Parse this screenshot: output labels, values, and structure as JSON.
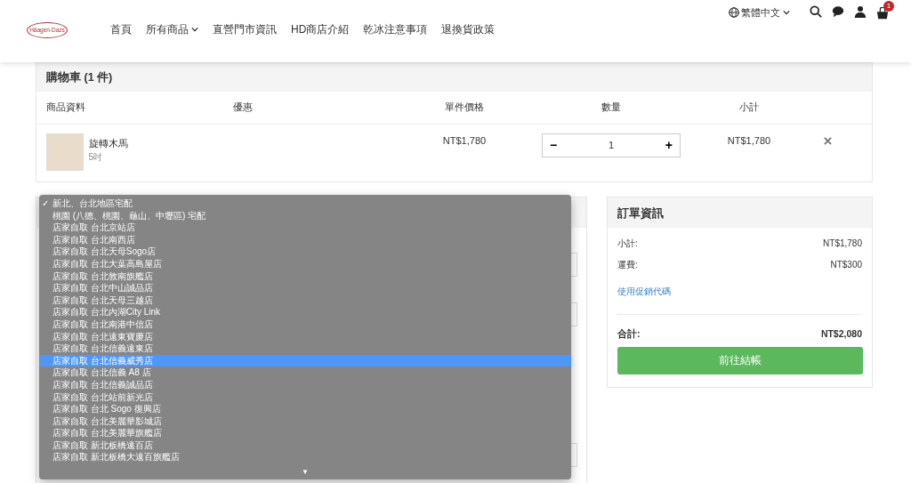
{
  "header": {
    "logo_text": "Häagen-Dazs",
    "nav": [
      {
        "label": "首頁",
        "dropdown": false
      },
      {
        "label": "所有商品",
        "dropdown": true
      },
      {
        "label": "直營門市資訊",
        "dropdown": false
      },
      {
        "label": "HD商店介紹",
        "dropdown": false
      },
      {
        "label": "乾冰注意事項",
        "dropdown": false
      },
      {
        "label": "退換貨政策",
        "dropdown": false
      }
    ],
    "language": "繁體中文",
    "cart_count": "1"
  },
  "cart": {
    "title": "購物車 (1 件)",
    "columns": [
      "商品資料",
      "優惠",
      "單件價格",
      "數量",
      "小計"
    ],
    "items": [
      {
        "name": "旋轉木馬",
        "variant": "5吋",
        "price": "NT$1,780",
        "decrement": "−",
        "quantity": "1",
        "increment": "+",
        "subtotal": "NT$1,780"
      }
    ]
  },
  "delivery_dropdown": {
    "options": [
      {
        "label": "新北、台北地區宅配",
        "selected": true,
        "highlighted": false
      },
      {
        "label": "桃園 (八德、桃園、龜山、中壢區) 宅配",
        "selected": false,
        "highlighted": false
      },
      {
        "label": "店家自取 台北京站店",
        "selected": false,
        "highlighted": false
      },
      {
        "label": "店家自取 台北南西店",
        "selected": false,
        "highlighted": false
      },
      {
        "label": "店家自取 台北天母Sogo店",
        "selected": false,
        "highlighted": false
      },
      {
        "label": "店家自取 台北大葉高島屋店",
        "selected": false,
        "highlighted": false
      },
      {
        "label": "店家自取 台北敦南旗艦店",
        "selected": false,
        "highlighted": false
      },
      {
        "label": "店家自取 台北中山誠品店",
        "selected": false,
        "highlighted": false
      },
      {
        "label": "店家自取 台北天母三越店",
        "selected": false,
        "highlighted": false
      },
      {
        "label": "店家自取 台北內湖City Link",
        "selected": false,
        "highlighted": false
      },
      {
        "label": "店家自取 台北南港中信店",
        "selected": false,
        "highlighted": false
      },
      {
        "label": "店家自取 台北遠東寶慶店",
        "selected": false,
        "highlighted": false
      },
      {
        "label": "店家自取 台北信義遠東店",
        "selected": false,
        "highlighted": false
      },
      {
        "label": "店家自取 台北信義威秀店",
        "selected": false,
        "highlighted": true
      },
      {
        "label": "店家自取 台北信義 A8 店",
        "selected": false,
        "highlighted": false
      },
      {
        "label": "店家自取 台北信義誠品店",
        "selected": false,
        "highlighted": false
      },
      {
        "label": "店家自取 台北站前新光店",
        "selected": false,
        "highlighted": false
      },
      {
        "label": "店家自取 台北 Sogo 復興店",
        "selected": false,
        "highlighted": false
      },
      {
        "label": "店家自取 台北美麗華影城店",
        "selected": false,
        "highlighted": false
      },
      {
        "label": "店家自取 台北美麗華旗艦店",
        "selected": false,
        "highlighted": false
      },
      {
        "label": "店家自取 新北板橋遠百店",
        "selected": false,
        "highlighted": false
      },
      {
        "label": "店家自取 新北板橋大遠百旗艦店",
        "selected": false,
        "highlighted": false
      }
    ],
    "check_mark": "✓",
    "scroll_indicator": "▼"
  },
  "order_summary": {
    "title": "訂單資訊",
    "rows": [
      {
        "label": "小計:",
        "value": "NT$1,780"
      },
      {
        "label": "運費:",
        "value": "NT$300"
      }
    ],
    "promo_link": "使用促銷代碼",
    "total_label": "合計:",
    "total_value": "NT$2,080",
    "checkout_button": "前往結帳"
  }
}
